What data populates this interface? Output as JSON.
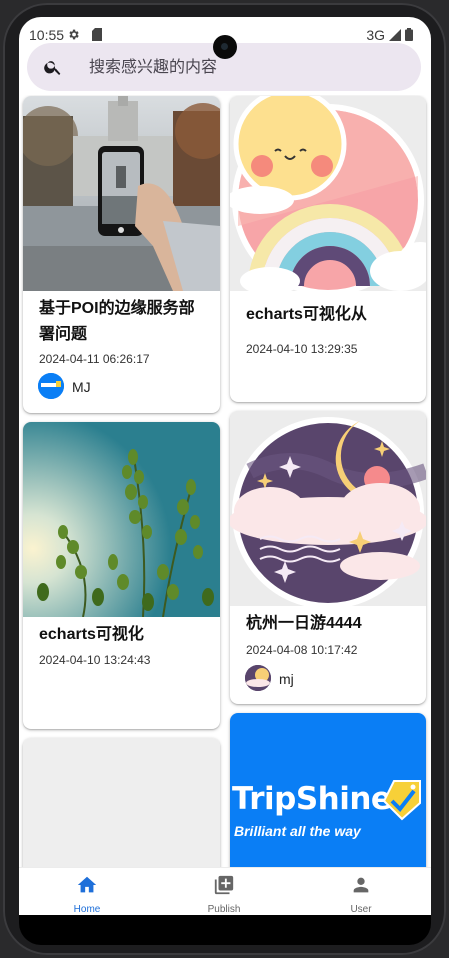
{
  "status_bar": {
    "time": "10:55",
    "network": "3G",
    "icons": [
      "gear-icon",
      "sim-card-icon",
      "signal-icon",
      "battery-icon"
    ]
  },
  "search": {
    "placeholder": "搜索感兴趣的内容",
    "icon": "search-icon"
  },
  "feed": {
    "left_column": [
      {
        "image": "photo-of-hand-holding-phone-in-front-of-building",
        "title": "基于POI的边缘服务部署问题",
        "time": "2024-04-11 06:26:17",
        "author": "MJ",
        "avatar": "tripshine-logo-avatar"
      },
      {
        "image": "photo-of-green-plants-against-sky",
        "title": "echarts可视化",
        "time": "2024-04-10 13:24:43",
        "author": "",
        "avatar": ""
      },
      {
        "image": "loading-placeholder",
        "title": "",
        "time": "",
        "author": "",
        "avatar": ""
      }
    ],
    "right_column": [
      {
        "image": "sun-and-rainbow-illustration",
        "title": "echarts可视化从",
        "time": "2024-04-10 13:29:35",
        "author": "",
        "avatar": ""
      },
      {
        "image": "moon-and-stars-night-illustration",
        "title": "杭州一日游4444",
        "time": "2024-04-08 10:17:42",
        "author": "mj",
        "avatar": "moon-illustration-avatar"
      },
      {
        "image": "tripshine-banner",
        "brand_title": "TripShine",
        "brand_tagline": "Brilliant all the way",
        "title": "",
        "time": "",
        "author": "",
        "avatar": ""
      }
    ]
  },
  "bottom_nav": {
    "items": [
      {
        "label": "Home",
        "icon": "home-icon",
        "active": true
      },
      {
        "label": "Publish",
        "icon": "add-box-icon",
        "active": false
      },
      {
        "label": "User",
        "icon": "person-icon",
        "active": false
      }
    ]
  },
  "colors": {
    "search_bg": "#ece6f0",
    "active_nav": "#1e6fd9",
    "inactive_nav": "#666666",
    "tripshine_blue": "#0a7ef5",
    "tripshine_yellow": "#f7d038"
  }
}
